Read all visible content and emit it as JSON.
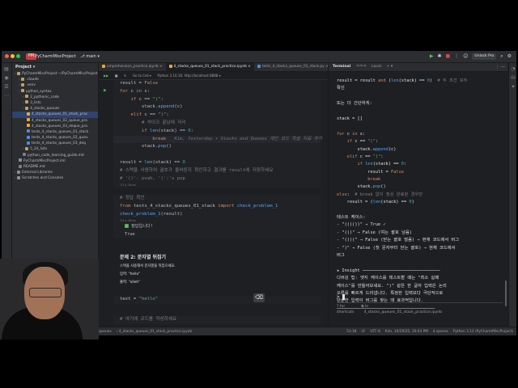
{
  "titlebar": {
    "project_badge": "PM",
    "project_name": "PyCharmMiscProject",
    "branch": "main",
    "unlock_label": "Unlock Pro"
  },
  "project_panel": {
    "header": "Project",
    "tree": [
      {
        "label": "PyCharmMiscProject ~/PyCharmMiscProject",
        "indent": 0,
        "type": "folder"
      },
      {
        "label": ".claude",
        "indent": 1,
        "type": "folder"
      },
      {
        "label": ".venv",
        "indent": 1,
        "type": "folder"
      },
      {
        "label": "python_syntax",
        "indent": 1,
        "type": "folder"
      },
      {
        "label": "2_pythonic_code",
        "indent": 2,
        "type": "folder"
      },
      {
        "label": "3_lists",
        "indent": 2,
        "type": "folder"
      },
      {
        "label": "4_stacks_queues",
        "indent": 2,
        "type": "folder"
      },
      {
        "label": "4_stacks_queues_01_stack_prac",
        "indent": 3,
        "type": "nb",
        "selected": true
      },
      {
        "label": "4_stacks_queues_02_queue_pra",
        "indent": 3,
        "type": "nb"
      },
      {
        "label": "4_stacks_queues_03_deque_pra",
        "indent": 3,
        "type": "nb"
      },
      {
        "label": "tests_4_stacks_queues_01_stack",
        "indent": 3,
        "type": "py"
      },
      {
        "label": "tests_4_stacks_queues_02_queu",
        "indent": 3,
        "type": "py"
      },
      {
        "label": "tests_4_stacks_queues_03_deq",
        "indent": 3,
        "type": "py"
      },
      {
        "label": "5_2d_lists",
        "indent": 2,
        "type": "folder"
      },
      {
        "label": "python_code_learning_guide.md",
        "indent": 2,
        "type": "md"
      },
      {
        "label": "PyCharmMiscProject.iml",
        "indent": 1,
        "type": "file"
      },
      {
        "label": "README.md",
        "indent": 1,
        "type": "md"
      },
      {
        "label": "External Libraries",
        "indent": 0,
        "type": "lib"
      },
      {
        "label": "Scratches and Consoles",
        "indent": 0,
        "type": "lib"
      }
    ]
  },
  "editor": {
    "tabs": [
      {
        "label": "omprehension_practice.ipynb",
        "active": false
      },
      {
        "label": "4_stacks_queues_01_stack_practice.ipynb",
        "active": true
      },
      {
        "label": "tests_4_stacks_queues_01_stack.py",
        "active": false
      }
    ],
    "toolbar": [
      "Go to Cell ▾",
      "Python 3.10.18: http://localhost:8888 ▾"
    ],
    "cell1": {
      "lines": [
        "result = False",
        "for c in s:",
        "    if c == \"(\":",
        "        stack.append(c)",
        "    elif c == \")\":",
        "        # 석이크 끝남에 저리",
        "        if len(stack) == 0:",
        "            break",
        "        stack.pop()",
        "",
        "result = len(stack) == 0",
        "# 스택을 사용하여 괄호가 올바른지 확인하고 결과를 result에 저장하세요",
        "# '()': pvah, ')':'s pop"
      ],
      "ghost": "Kim, Yesterday • Stacks and Queues 개인 코드 학습 자료 추가",
      "meta": "7/1 ▸ 16ms"
    },
    "cell2": {
      "lines": [
        "# 정답 확인",
        "from tests_4_stacks_queues_01_stack import check_problem_1",
        "check_problem_1(result)"
      ],
      "meta": "7/1 ▸ 16ms",
      "output": [
        "정답입니다!",
        "True"
      ]
    },
    "cell3": {
      "title": "문제 2: 문자열 뒤집기",
      "desc": "스택을 사용해서 문자열을 뒤집으세요.",
      "input_line": "입력: \"hello\"",
      "output_line": "출력: \"olleh\""
    },
    "cell4": {
      "lines": [
        "text = \"hello\""
      ]
    },
    "cell5": {
      "lines": [
        "# 여기에 코드를 작성하세요"
      ]
    }
  },
  "terminal": {
    "header": {
      "title": "Terminal",
      "tab1": "ㅋㅋㅋ",
      "tab2": "Local"
    },
    "lines": [
      "result = result and (len(stack) == 0)  # 두 조건 모두",
      "확인",
      "",
      "또는 더 간단하게:",
      "",
      "stack = []",
      "",
      "for c in s:",
      "    if c == \"(\":",
      "        stack.append(c)",
      "    elif c == \")\":",
      "        if len(stack) == 0:",
      "            result = False",
      "            break",
      "        stack.pop()",
      "else:  # break 없이 정상 완료된 경우만",
      "    result = (len(stack) == 0)",
      "",
      "테스트 케이스:",
      "- \"(()())\" → True ✓",
      "- \"(()\" → False (여는 괄호 남음)",
      "- \"())(\" → False (닫는 괄호 많음) → 현재 코드에서 버그",
      "- \")\" → False (첫 문자부터 닫는 괄호) → 현재 코드에서",
      "버그",
      "",
      "★ Insight ──────────────────────────────",
      "디버깅 팁: 엣지 케이스를 테스트할 때는 \"최소 실패",
      "케이스\"를 만들어보세요. \")\" 같은 한 글자 입력은 논리",
      "오류를 빠르게 드러냅니다. 특정한 입력보다 극단적으로",
      "단순한 입력이 버그를 찾는 데 효과적입니다.",
      "──────────────────────────────────────"
    ],
    "prompt": ">",
    "footer": {
      "shortcut_key": "? for",
      "shortcut_label": "shortcuts",
      "mode": "⧉ In",
      "file": "4_stacks_queues_01_stack_practice.ipynb"
    }
  },
  "statusbar": {
    "left": [
      "PyCharmMiscProject",
      "python_syntax",
      "4_stacks_queues",
      "4_stacks_queues_01_stack_practice.ipynb"
    ],
    "right": [
      "53:18",
      "LF",
      "UTF-8",
      "Kim, 10/29/25, 10:43 PM",
      "4 spaces",
      "Python 3.12 (PyCharmMiscProject)"
    ]
  },
  "colors": {
    "accent": "#3574f0",
    "keyword": "#cf8e6d",
    "string": "#6aab73",
    "number": "#2aacb8",
    "comment": "#7a7e85",
    "badge": "#c93e3e"
  }
}
